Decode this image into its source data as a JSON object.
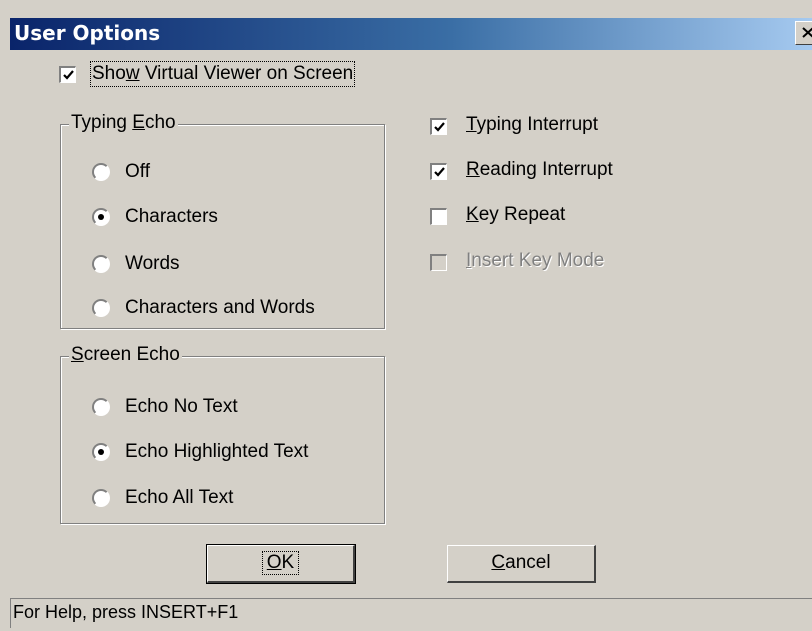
{
  "window": {
    "title": "User Options",
    "close_glyph": "×"
  },
  "show_viewer": {
    "pre": "Sho",
    "key": "w",
    "post": " Virtual Viewer on Screen",
    "checked": true
  },
  "typing_echo": {
    "legend_pre": "Typing ",
    "legend_key": "E",
    "legend_post": "cho",
    "options": [
      {
        "label": "Off",
        "selected": false
      },
      {
        "label": "Characters",
        "selected": true
      },
      {
        "label": "Words",
        "selected": false
      },
      {
        "label": "Characters and Words",
        "selected": false
      }
    ]
  },
  "screen_echo": {
    "legend_key": "S",
    "legend_post": "creen Echo",
    "options": [
      {
        "label": "Echo No Text",
        "selected": false
      },
      {
        "label": "Echo Highlighted Text",
        "selected": true
      },
      {
        "label": "Echo All Text",
        "selected": false
      }
    ]
  },
  "checkboxes": [
    {
      "key": "T",
      "rest": "yping Interrupt",
      "checked": true,
      "disabled": false
    },
    {
      "key": "R",
      "rest": "eading Interrupt",
      "checked": true,
      "disabled": false
    },
    {
      "key": "K",
      "rest": "ey Repeat",
      "checked": false,
      "disabled": false
    },
    {
      "key": "I",
      "rest": "nsert Key Mode",
      "checked": false,
      "disabled": true
    }
  ],
  "buttons": {
    "ok_key": "O",
    "ok_rest": "K",
    "cancel_key": "C",
    "cancel_rest": "ancel"
  },
  "status": {
    "text": "For Help, press INSERT+F1"
  }
}
